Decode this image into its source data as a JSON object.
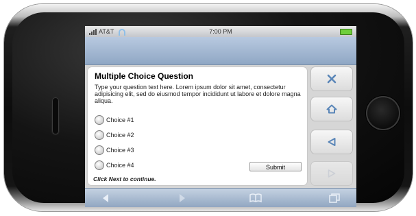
{
  "status_bar": {
    "carrier": "AT&T",
    "time": "7:00 PM"
  },
  "question": {
    "title": "Multiple Choice Question",
    "text": "Type your question text here. Lorem ipsum dolor sit amet, consectetur adipisicing elit, sed do eiusmod tempor incididunt ut labore et dolore magna aliqua.",
    "choices": [
      "Choice #1",
      "Choice #2",
      "Choice #3",
      "Choice #4"
    ],
    "submit_label": "Submit",
    "hint": "Click Next to continue."
  },
  "side_buttons": [
    {
      "icon": "close-icon"
    },
    {
      "icon": "home-icon"
    },
    {
      "icon": "back-icon"
    },
    {
      "icon": "next-icon",
      "disabled": true
    }
  ],
  "toolbar": [
    "back-arrow-icon",
    "forward-arrow-icon",
    "bookmarks-icon",
    "pages-icon"
  ],
  "colors": {
    "accent_blue": "#6f8fb8",
    "side_icon": "#5a86b8"
  }
}
